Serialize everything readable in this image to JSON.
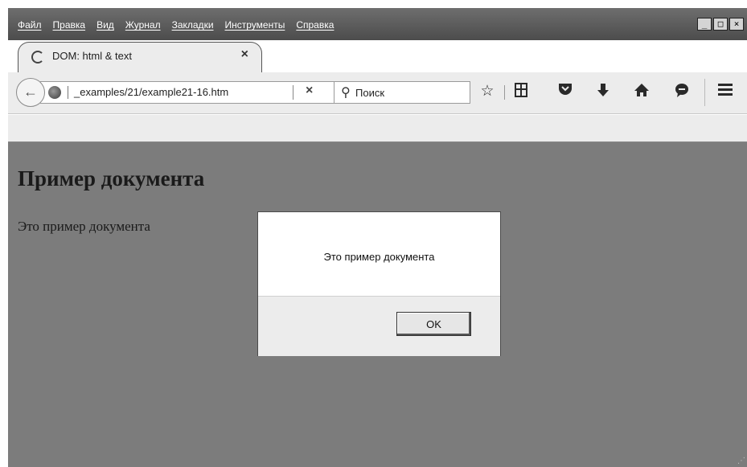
{
  "menubar": {
    "items": [
      "Файл",
      "Правка",
      "Вид",
      "Журнал",
      "Закладки",
      "Инструменты",
      "Справка"
    ]
  },
  "window_controls": {
    "minimize": "_",
    "maximize": "□",
    "close": "×"
  },
  "tab": {
    "title": "DOM: html & text",
    "close": "×"
  },
  "newtab": {
    "label": "+"
  },
  "navbar": {
    "back_icon": "←",
    "url": "_examples/21/example21-16.htm",
    "stop_icon": "×",
    "search_placeholder": "Поиск",
    "icons": [
      "star-icon",
      "reading-list-icon",
      "pocket-icon",
      "download-icon",
      "home-icon",
      "chat-icon",
      "menu-icon"
    ]
  },
  "page": {
    "heading": "Пример документа",
    "paragraph": "Это пример документа"
  },
  "dialog": {
    "message": "Это пример документа",
    "ok_label": "OK"
  }
}
